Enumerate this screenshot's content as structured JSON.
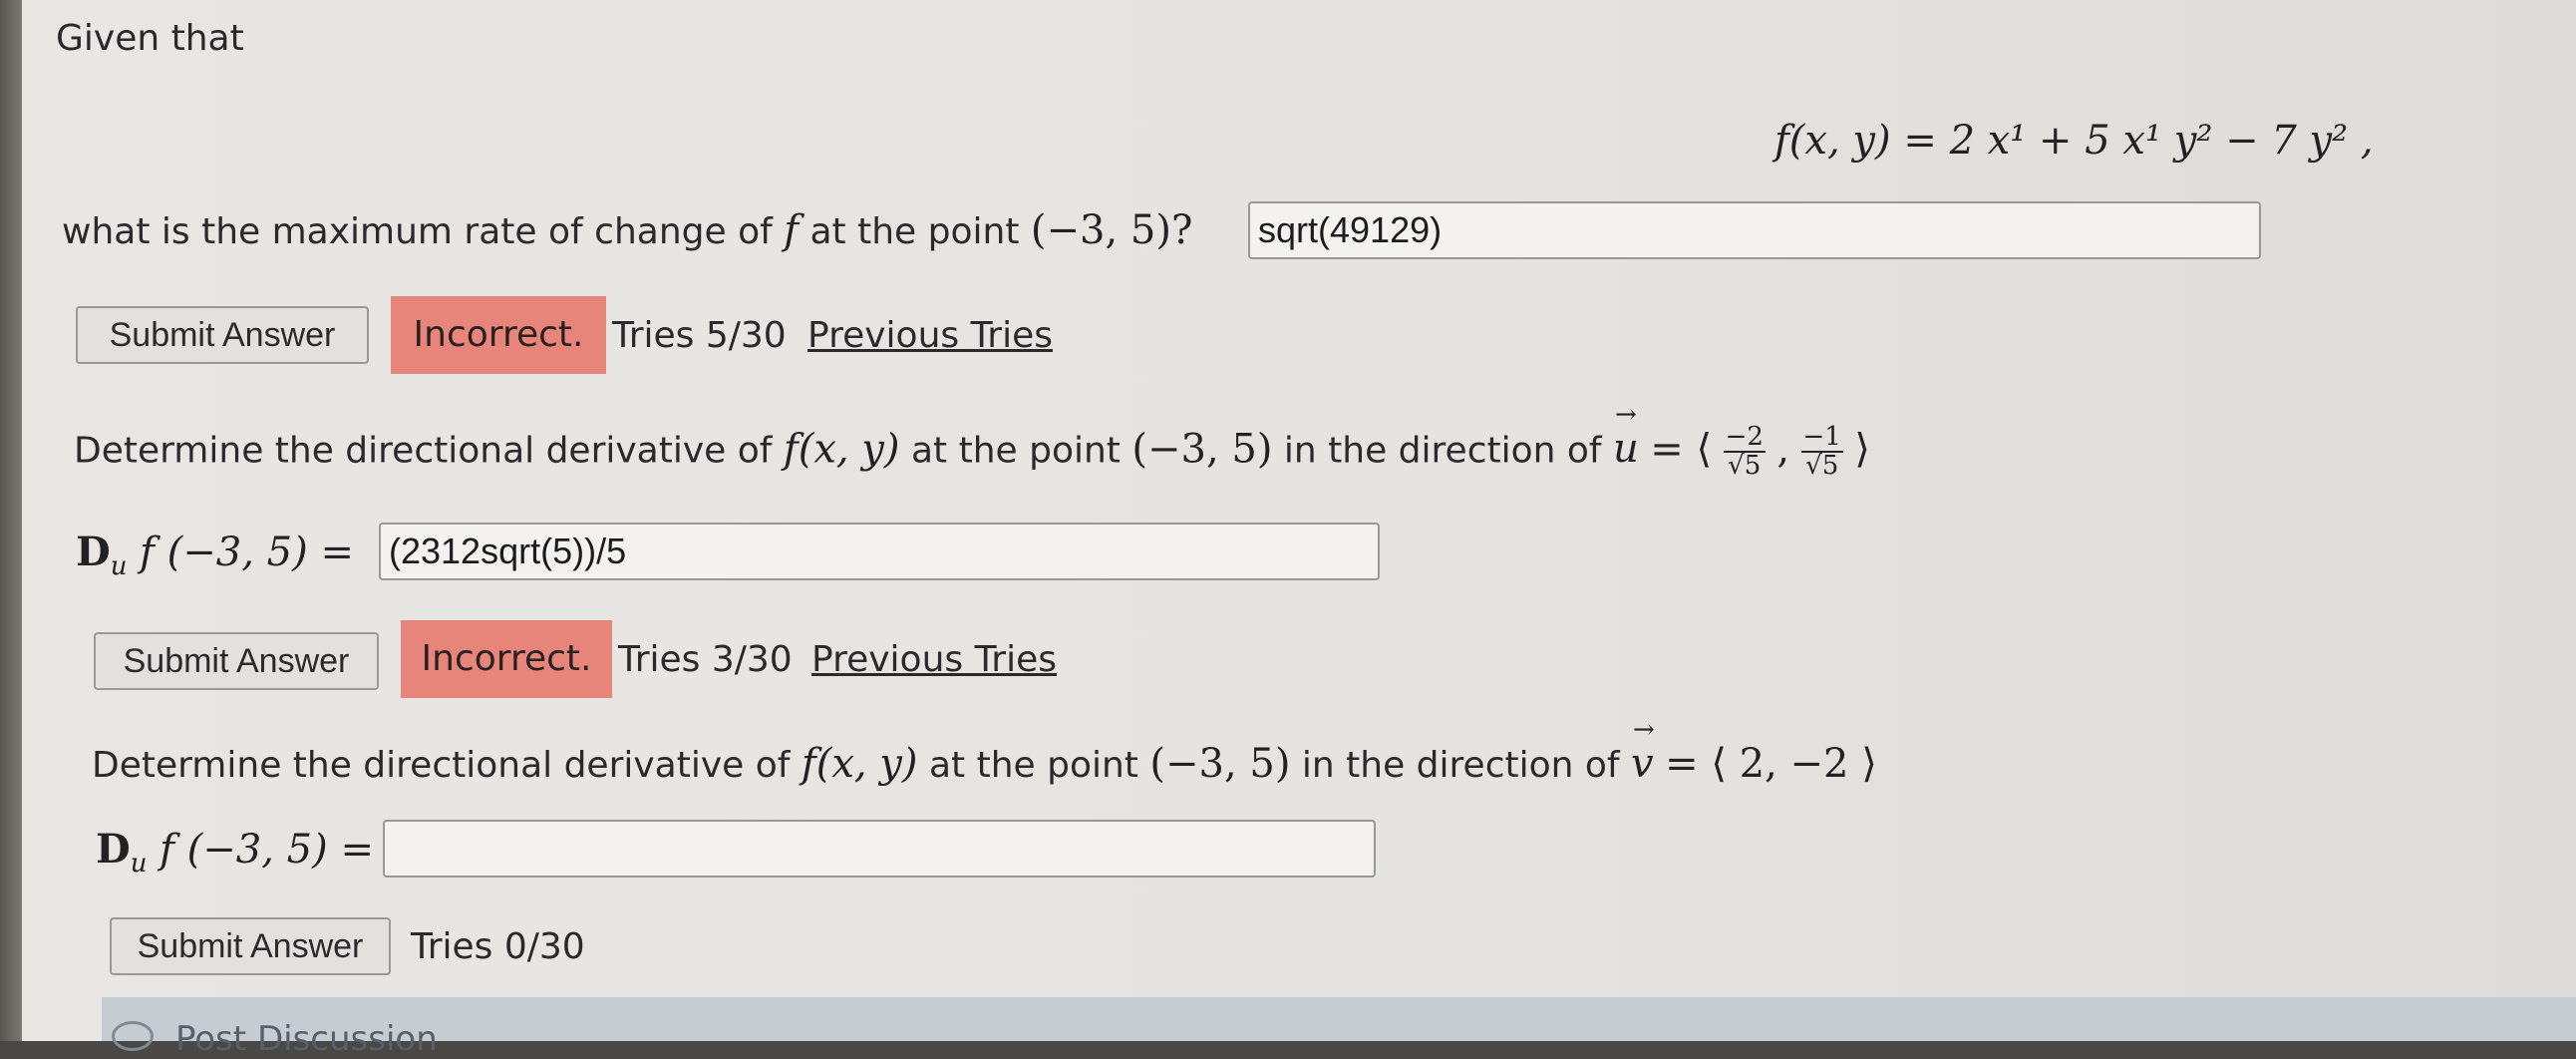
{
  "q1": {
    "intro": "Given that",
    "function_lhs": "f(x, y) =",
    "function_rhs": "2 x¹ + 5 x¹ y² − 7 y² ,",
    "question": "what is the maximum rate of change of",
    "f": "f",
    "at_point": "at the point",
    "point": "(−3, 5)?",
    "answer_value": "sqrt(49129)",
    "submit_label": "Submit Answer",
    "status": "Incorrect.",
    "tries": "Tries 5/30",
    "previous_tries": "Previous Tries"
  },
  "q2": {
    "prompt_start": "Determine the directional derivative of",
    "fxy": "f(x, y)",
    "prompt_mid": "at the point",
    "point": "(−3, 5)",
    "prompt_dir": "in the direction of",
    "vec": "u",
    "eq_open": "= ⟨",
    "frac1_num": "−2",
    "frac1_den": "√5",
    "comma": ",",
    "frac2_num": "−1",
    "frac2_den": "√5",
    "close": "⟩",
    "label_D": "D",
    "label_sub": "u",
    "label_rest": "f (−3, 5) =",
    "answer_value": "(2312sqrt(5))/5",
    "submit_label": "Submit Answer",
    "status": "Incorrect.",
    "tries": "Tries 3/30",
    "previous_tries": "Previous Tries"
  },
  "q3": {
    "prompt_start": "Determine the directional derivative of",
    "fxy": "f(x, y)",
    "prompt_mid": "at the point",
    "point": "(−3, 5)",
    "prompt_dir": "in the direction of",
    "vec": "v",
    "vec_value": "= ⟨ 2, −2 ⟩",
    "label_D": "D",
    "label_sub": "u",
    "label_rest": "f (−3, 5) =",
    "answer_value": "",
    "submit_label": "Submit Answer",
    "tries": "Tries 0/30"
  },
  "footer": {
    "text": "Post Discussion"
  },
  "colors": {
    "incorrect_badge": "#e8857b",
    "page_background": "#e7e5e1",
    "footer_band": "#c5cdd2"
  }
}
